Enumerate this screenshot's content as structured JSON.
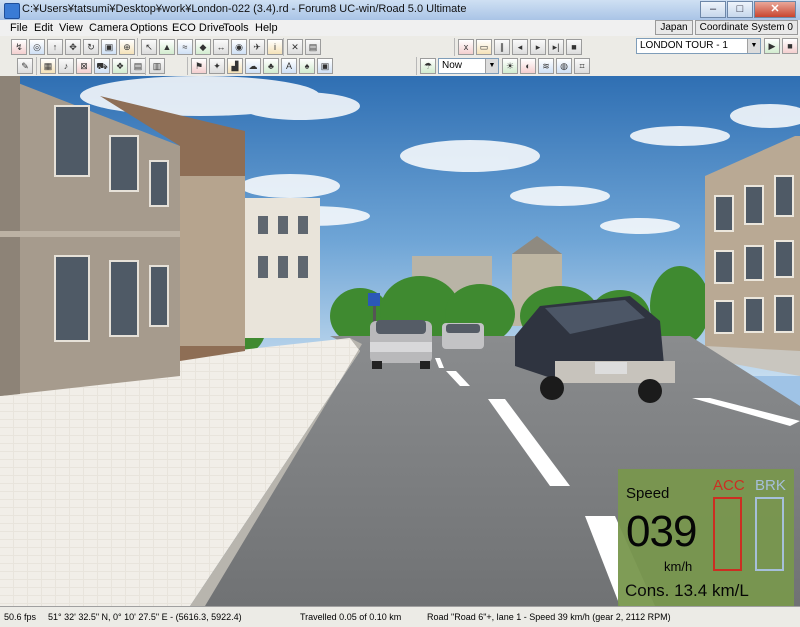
{
  "window": {
    "title": "C:¥Users¥tatsumi¥Desktop¥work¥London-022 (3.4).rd - Forum8 UC-win/Road 5.0 Ultimate"
  },
  "menu": [
    "File",
    "Edit",
    "View",
    "Camera",
    "Options",
    "ECO Drive",
    "Tools",
    "Help"
  ],
  "top_right": {
    "region": "Japan",
    "coord": "Coordinate System 0"
  },
  "toolbar": {
    "time_select": "Now",
    "tour_select": "LONDON TOUR - 1"
  },
  "hud": {
    "speed_label": "Speed",
    "speed_value": "039",
    "speed_unit": "km/h",
    "acc_label": "ACC",
    "brk_label": "BRK",
    "consumption": "Cons. 13.4 km/L",
    "acc_level": 0,
    "brk_level": 0,
    "colors": {
      "panel": "#79974e",
      "acc": "#d12b1e",
      "brk": "#a9c3df"
    }
  },
  "status": {
    "fps": "50.6 fps",
    "coords": "51°  32' 32.5\" N, 0°  10' 27.5\" E  -  (5616.3, 5922.4)",
    "travelled": "Travelled 0.05 of 0.10 km",
    "road": "Road \"Road 6\"+, lane 1 - Speed 39 km/h (gear 2, 2112 RPM)"
  },
  "icons": [
    "app-icon",
    "minimize-icon",
    "maximize-icon",
    "close-icon",
    "play-icon",
    "pause-icon",
    "stop-icon",
    "step-back-icon",
    "step-forward-icon",
    "dropdown-arrow-icon",
    "road-sign-icon"
  ]
}
